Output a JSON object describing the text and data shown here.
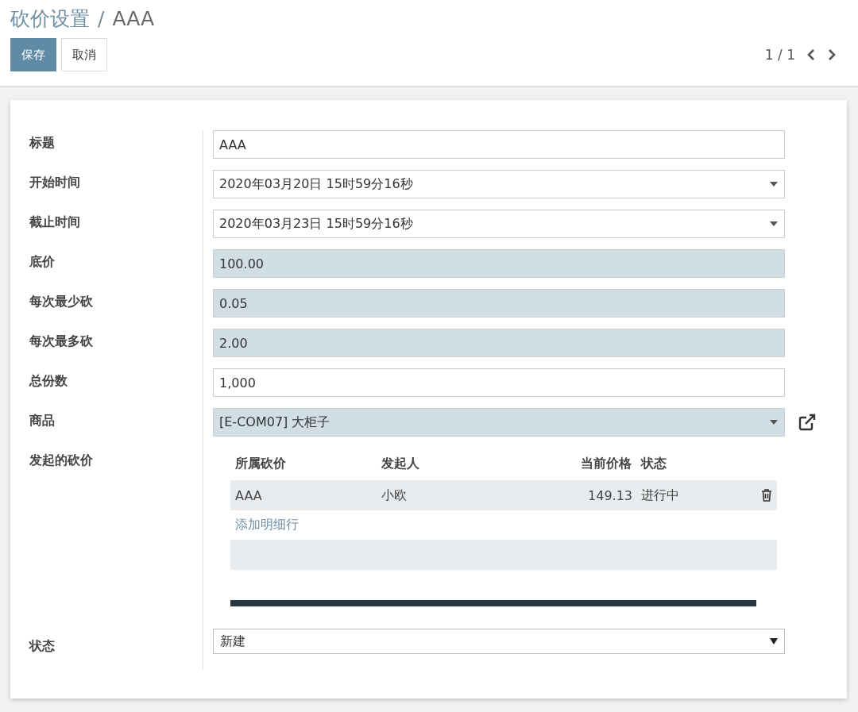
{
  "breadcrumb": {
    "parent": "砍价设置",
    "separator": "/",
    "current": "AAA"
  },
  "buttons": [
    {
      "label": "保存",
      "kind": "primary"
    },
    {
      "label": "取消",
      "kind": "secondary"
    }
  ],
  "pager": {
    "text": "1 / 1"
  },
  "fields": [
    {
      "label": "标题",
      "kind": "text",
      "value": "AAA",
      "required": false
    },
    {
      "label": "开始时间",
      "kind": "date",
      "value": "2020年03月20日 15时59分16秒",
      "required": false
    },
    {
      "label": "截止时间",
      "kind": "date",
      "value": "2020年03月23日 15时59分16秒",
      "required": false
    },
    {
      "label": "底价",
      "kind": "text",
      "value": "100.00",
      "required": true
    },
    {
      "label": "每次最少砍",
      "kind": "text",
      "value": "0.05",
      "required": true
    },
    {
      "label": "每次最多砍",
      "kind": "text",
      "value": "2.00",
      "required": true
    },
    {
      "label": "总份数",
      "kind": "text",
      "value": "1,000",
      "required": false
    },
    {
      "label": "商品",
      "kind": "many2one",
      "value": "[E-COM07] 大柜子",
      "required": true
    }
  ],
  "lines": {
    "label": "发起的砍价",
    "columns": [
      {
        "title": "所属砍价",
        "kind": "text"
      },
      {
        "title": "发起人",
        "kind": "text"
      },
      {
        "title": "当前价格",
        "kind": "number"
      },
      {
        "title": "状态",
        "kind": "text"
      }
    ],
    "rows": [
      {
        "cells": [
          "AAA",
          "小欧",
          "149.13",
          "进行中"
        ]
      }
    ],
    "add_line": "添加明细行"
  },
  "status": {
    "label": "状态",
    "value": "新建"
  }
}
